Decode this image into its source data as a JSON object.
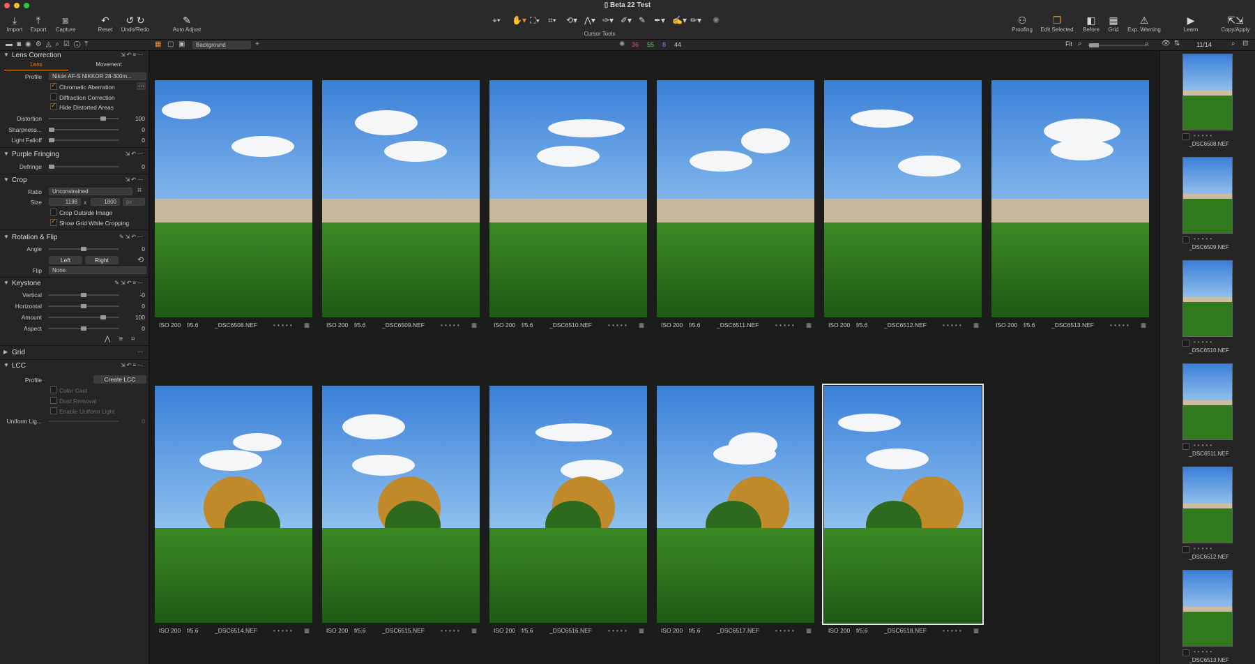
{
  "window": {
    "title": "Beta 22 Test"
  },
  "toolbar": {
    "import": "Import",
    "export": "Export",
    "capture": "Capture",
    "reset": "Reset",
    "undo_redo": "Undo/Redo",
    "auto_adjust": "Auto Adjust",
    "cursor_tools": "Cursor Tools",
    "proofing": "Proofing",
    "edit_selected": "Edit Selected",
    "before": "Before",
    "grid": "Grid",
    "exp_warning": "Exp. Warning",
    "learn": "Learn",
    "copy_apply": "Copy/Apply"
  },
  "secondbar": {
    "layer": "Background",
    "counts": {
      "red": "36",
      "green": "55",
      "blue": "8",
      "total": "44"
    },
    "fit": "Fit",
    "position": "11/14"
  },
  "lens": {
    "title": "Lens Correction",
    "tab_lens": "Lens",
    "tab_movement": "Movement",
    "profile_label": "Profile",
    "profile_value": "Nikon AF-S NIKKOR 28-300m...",
    "chromatic": "Chromatic Aberration",
    "diffraction": "Diffraction Correction",
    "hide_distorted": "Hide Distorted Areas",
    "distortion_label": "Distortion",
    "distortion_value": "100",
    "sharpness_label": "Sharpness...",
    "sharpness_value": "0",
    "falloff_label": "Light Falloff",
    "falloff_value": "0"
  },
  "purple": {
    "title": "Purple Fringing",
    "defringe_label": "Defringe",
    "defringe_value": "0"
  },
  "crop": {
    "title": "Crop",
    "ratio_label": "Ratio",
    "ratio_value": "Unconstrained",
    "size_label": "Size",
    "width": "1198",
    "x": "x",
    "height": "1800",
    "unit": "px",
    "outside": "Crop Outside Image",
    "show_grid": "Show Grid While Cropping"
  },
  "rotation": {
    "title": "Rotation & Flip",
    "angle_label": "Angle",
    "angle_value": "0",
    "left": "Left",
    "right": "Right",
    "flip_label": "Flip",
    "flip_value": "None"
  },
  "keystone": {
    "title": "Keystone",
    "vertical_label": "Vertical",
    "vertical_value": "-0",
    "horizontal_label": "Horizontal",
    "horizontal_value": "0",
    "amount_label": "Amount",
    "amount_value": "100",
    "aspect_label": "Aspect",
    "aspect_value": "0"
  },
  "grid_section": {
    "title": "Grid"
  },
  "lcc": {
    "title": "LCC",
    "profile_label": "Profile",
    "create": "Create LCC",
    "color_cast": "Color Cast",
    "dust": "Dust Removal",
    "uniform_light": "Enable Uniform Light",
    "uniform_label": "Uniform Lig...",
    "uniform_value": "0"
  },
  "images": [
    {
      "iso": "ISO 200",
      "f": "f/5.6",
      "name": "_DSC6508.NEF"
    },
    {
      "iso": "ISO 200",
      "f": "f/5.6",
      "name": "_DSC6509.NEF"
    },
    {
      "iso": "ISO 200",
      "f": "f/5.6",
      "name": "_DSC6510.NEF"
    },
    {
      "iso": "ISO 200",
      "f": "f/5.6",
      "name": "_DSC6511.NEF"
    },
    {
      "iso": "ISO 200",
      "f": "f/5.6",
      "name": "_DSC6512.NEF"
    },
    {
      "iso": "ISO 200",
      "f": "f/5.6",
      "name": "_DSC6513.NEF"
    },
    {
      "iso": "ISO 200",
      "f": "f/5.6",
      "name": "_DSC6514.NEF"
    },
    {
      "iso": "ISO 200",
      "f": "f/5.6",
      "name": "_DSC6515.NEF"
    },
    {
      "iso": "ISO 200",
      "f": "f/5.6",
      "name": "_DSC6516.NEF"
    },
    {
      "iso": "ISO 200",
      "f": "f/5.6",
      "name": "_DSC6517.NEF"
    },
    {
      "iso": "ISO 200",
      "f": "f/5.6",
      "name": "_DSC6518.NEF"
    }
  ],
  "filmstrip": [
    "_DSC6508.NEF",
    "_DSC6509.NEF",
    "_DSC6510.NEF",
    "_DSC6511.NEF",
    "_DSC6512.NEF",
    "_DSC6513.NEF"
  ],
  "colors": {
    "accent": "#f08a24",
    "panel": "#252525",
    "viewer": "#1c1c1c"
  }
}
